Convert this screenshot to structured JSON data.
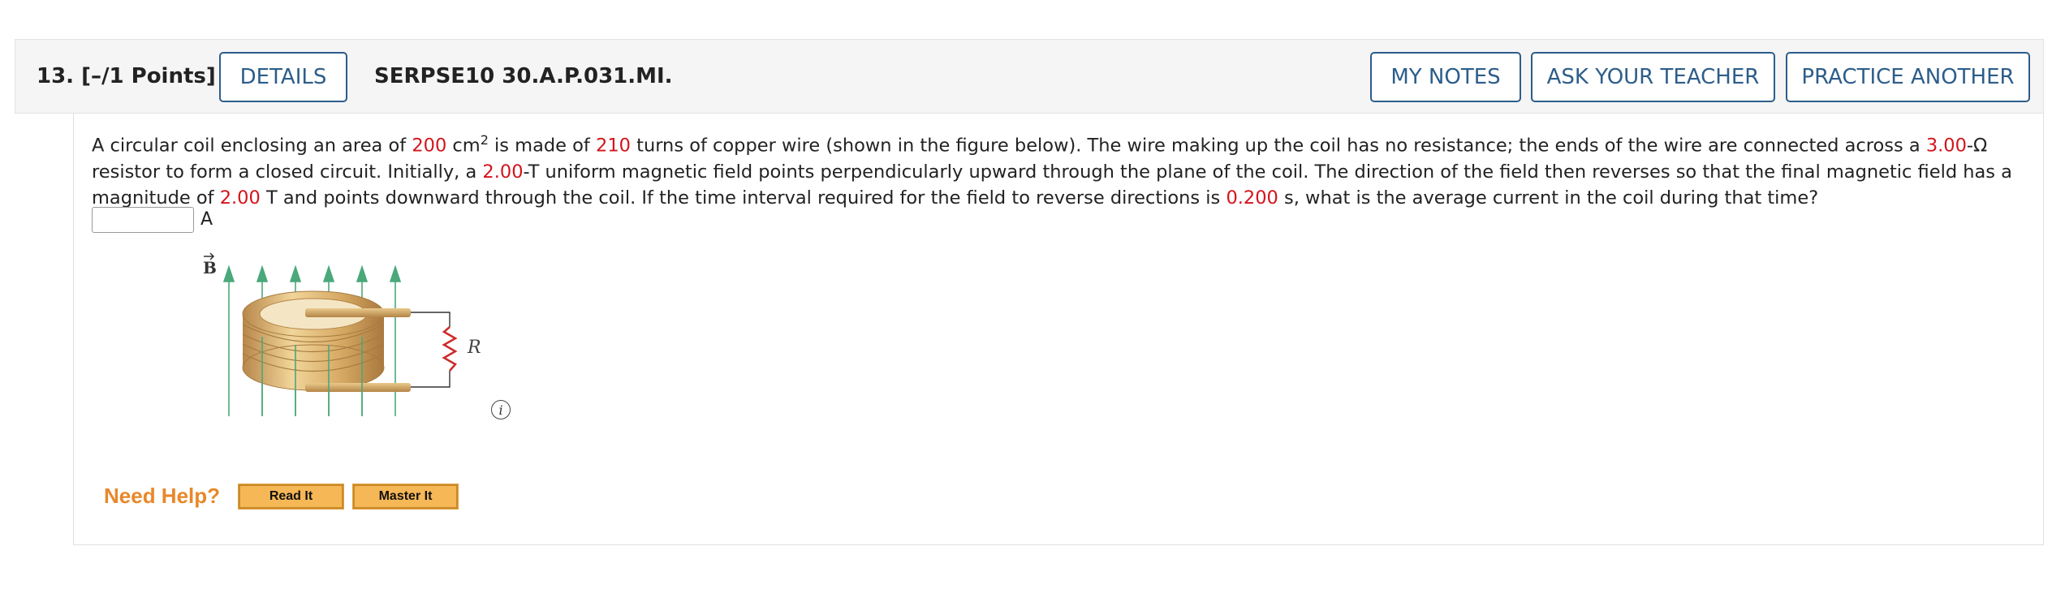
{
  "header": {
    "question_number": "13.  [–/1 Points]",
    "details_label": "DETAILS",
    "problem_code": "SERPSE10 30.A.P.031.MI.",
    "my_notes_label": "MY NOTES",
    "ask_teacher_label": "ASK YOUR TEACHER",
    "practice_another_label": "PRACTICE ANOTHER"
  },
  "question": {
    "t1": "A circular coil enclosing an area of ",
    "area": "200",
    "t2": " cm",
    "area_exp": "2",
    "t3": " is made of ",
    "turns": "210",
    "t4": " turns of copper wire (shown in the figure below). The wire making up the coil has no resistance; the ends of the wire are connected across a ",
    "resistance": "3.00",
    "t5": "-Ω resistor to form a closed circuit. Initially, a ",
    "field_initial": "2.00",
    "t6": "-T uniform magnetic field points perpendicularly upward through the plane of the coil. The direction of the field then reverses so that the final magnetic field has a magnitude of ",
    "field_final": "2.00",
    "t7": " T and points downward through the coil. If the time interval required for the field to reverse directions is ",
    "time": "0.200",
    "t8": " s, what is the average current in the coil during that time?"
  },
  "answer": {
    "value": "",
    "unit": "A"
  },
  "figure": {
    "field_label": "B",
    "resistor_label": "R",
    "info_icon_glyph": "i",
    "field_color": "#4aa87a",
    "resistor_color": "#cc2a2a",
    "coil_color": "#c9a063"
  },
  "help": {
    "label": "Need Help?",
    "read_it": "Read It",
    "master_it": "Master It"
  },
  "colors": {
    "accent_blue": "#2d5d8a",
    "value_red": "#d4141c",
    "help_orange": "#e8882a"
  }
}
